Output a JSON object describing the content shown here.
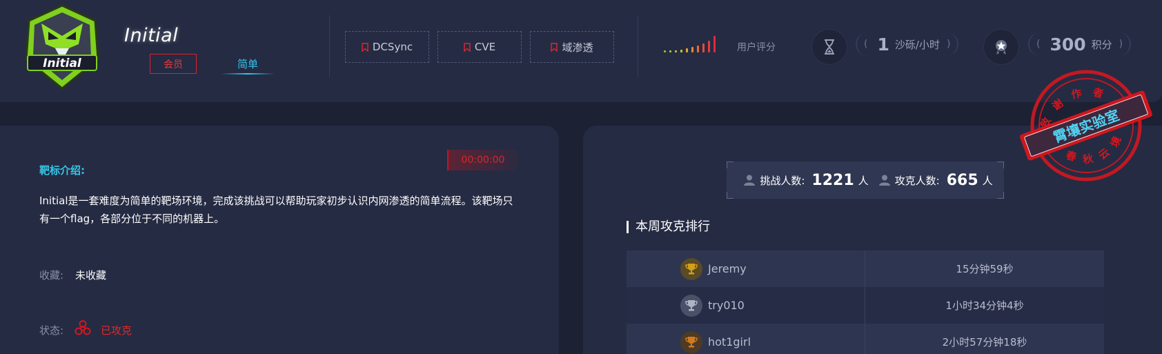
{
  "header": {
    "logo_text": "Initial",
    "title": "Initial",
    "member_badge": "会员",
    "difficulty": "简单",
    "tags": [
      "DCSync",
      "CVE",
      "域渗透"
    ],
    "rating": {
      "label": "用户评分",
      "bar_colors": [
        "#8bc34a",
        "#9ccc3a",
        "#b7cd2e",
        "#d2c42a",
        "#e8a528",
        "#ee8a2a",
        "#ef6a2f",
        "#ee4b34",
        "#e83a3a",
        "#e02a3a"
      ]
    },
    "sand": {
      "value": "1",
      "unit": "沙砾/小时",
      "open": "(",
      "close": ")"
    },
    "points": {
      "value": "300",
      "unit": "积分",
      "open": "(",
      "close": ")"
    }
  },
  "stamp": {
    "top_text": "致谢作者",
    "center_text": "霄壤实验室",
    "bottom_text": "春秋云境",
    "color": "#d6161e"
  },
  "target": {
    "timer": "00:00:00",
    "intro_label": "靶标介绍:",
    "intro_text": "Initial是一套难度为简单的靶场环境，完成该挑战可以帮助玩家初步认识内网渗透的简单流程。该靶场只有一个flag，各部分位于不同的机器上。",
    "favorite_label": "收藏:",
    "favorite_value": "未收藏",
    "status_label": "状态:",
    "status_value": "已攻克"
  },
  "stats": {
    "challengers_label": "挑战人数:",
    "challengers_value": "1221",
    "challengers_unit": "人",
    "solvers_label": "攻克人数:",
    "solvers_value": "665",
    "solvers_unit": "人"
  },
  "ranking": {
    "title": "本周攻克排行",
    "rows": [
      {
        "name": "Jeremy",
        "time": "15分钟59秒",
        "trophy_color": "#d4a017",
        "trophy_bg": "#5a4a26"
      },
      {
        "name": "try010",
        "time": "1小时34分钟4秒",
        "trophy_color": "#aeb4c4",
        "trophy_bg": "#4a5068"
      },
      {
        "name": "hot1girl",
        "time": "2小时57分钟18秒",
        "trophy_color": "#d07a1e",
        "trophy_bg": "#4e3b26"
      }
    ]
  }
}
